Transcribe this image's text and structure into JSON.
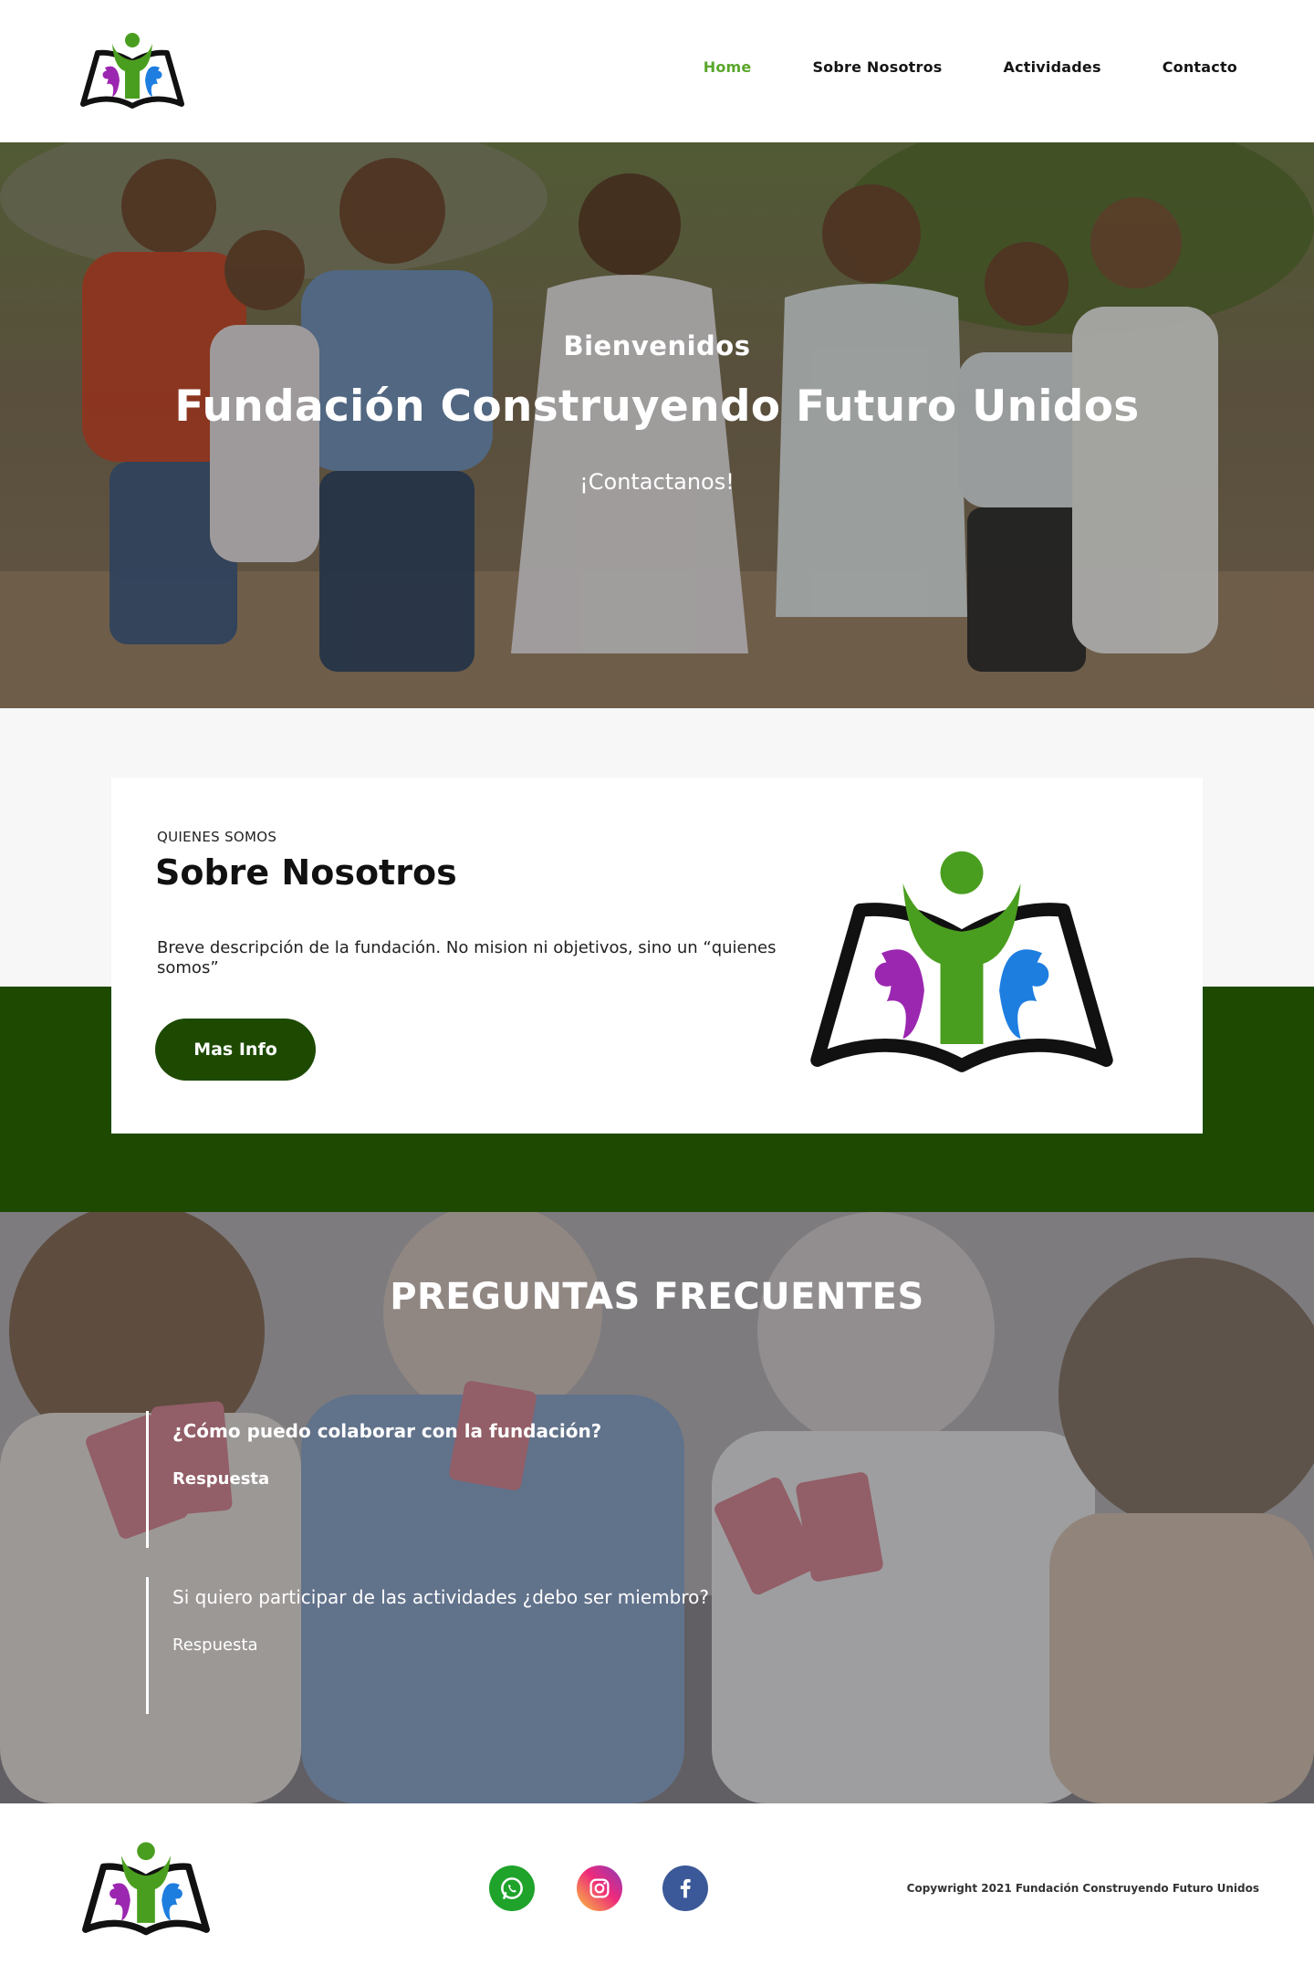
{
  "nav": {
    "logo_icon": "foundation-logo",
    "links": [
      {
        "label": "Home",
        "active": true
      },
      {
        "label": "Sobre Nosotros",
        "active": false
      },
      {
        "label": "Actividades",
        "active": false
      },
      {
        "label": "Contacto",
        "active": false
      }
    ],
    "active_color": "#5aa72a"
  },
  "hero": {
    "kicker": "Bienvenidos",
    "title": "Fundación Construyendo Futuro Unidos",
    "cta": "¡Contactanos!",
    "background_image": "children-group-photo"
  },
  "about": {
    "eyebrow": "QUIENES SOMOS",
    "title": "Sobre Nosotros",
    "description": "Breve descripción de la fundación. No mision ni objetivos, sino un “quienes somos”",
    "button_label": "Mas Info",
    "logo_icon": "foundation-logo",
    "accent_color": "#1d4a00"
  },
  "faq": {
    "title": "PREGUNTAS FRECUENTES",
    "background_image": "seniors-playing-cards-photo",
    "items": [
      {
        "question": "¿Cómo puedo colaborar con la fundación?",
        "answer": "Respuesta"
      },
      {
        "question": "Si quiero participar de las actividades ¿debo ser miembro?",
        "answer": "Respuesta"
      }
    ]
  },
  "footer": {
    "logo_icon": "foundation-logo",
    "social": [
      "whatsapp-icon",
      "instagram-icon",
      "facebook-icon"
    ],
    "copyright": "Copywright 2021 Fundación Construyendo Futuro Unidos"
  },
  "colors": {
    "logo_green": "#4a9e1f",
    "logo_purple": "#9b27b0",
    "logo_blue": "#1e7ee0"
  }
}
